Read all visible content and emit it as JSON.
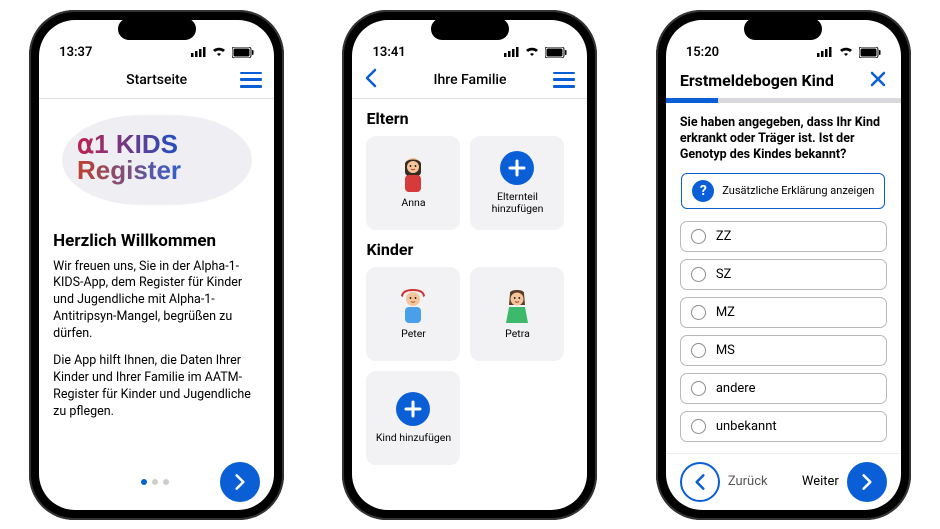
{
  "accent": "#0a5fd6",
  "phone1": {
    "time": "13:37",
    "nav_title": "Startseite",
    "logo_line1": "⍺1 KIDS",
    "logo_line2": "Register",
    "welcome_heading": "Herzlich Willkommen",
    "p1": "Wir freuen uns, Sie in der Alpha-1-KIDS-App, dem Register für Kinder und Jugendliche mit Alpha-1-Antitripsyn-Mangel, begrüßen zu dürfen.",
    "p2": "Die App hilft Ihnen, die Daten Ihrer Kinder und Ihrer Familie im AATM-Register für Kinder und Jugendliche zu pflegen.",
    "page_index": 0,
    "page_count": 3
  },
  "phone2": {
    "time": "13:41",
    "nav_title": "Ihre Familie",
    "section_parents": "Eltern",
    "section_children": "Kinder",
    "parents": [
      {
        "name": "Anna",
        "kind": "avatar-woman"
      }
    ],
    "add_parent_label": "Elternteil hinzufügen",
    "children": [
      {
        "name": "Peter",
        "kind": "avatar-boy"
      },
      {
        "name": "Petra",
        "kind": "avatar-girl"
      }
    ],
    "add_child_label": "Kind hinzufügen"
  },
  "phone3": {
    "time": "15:20",
    "form_title": "Erstmeldebogen Kind",
    "progress_pct": 22,
    "question": "Sie haben angegeben, dass Ihr Kind erkrankt oder Träger ist. Ist der Genotyp des Kindes bekannt?",
    "hint_label": "Zusätzliche Erklärung anzeigen",
    "options": [
      "ZZ",
      "SZ",
      "MZ",
      "MS",
      "andere",
      "unbekannt"
    ],
    "back_label": "Zurück",
    "next_label": "Weiter"
  }
}
